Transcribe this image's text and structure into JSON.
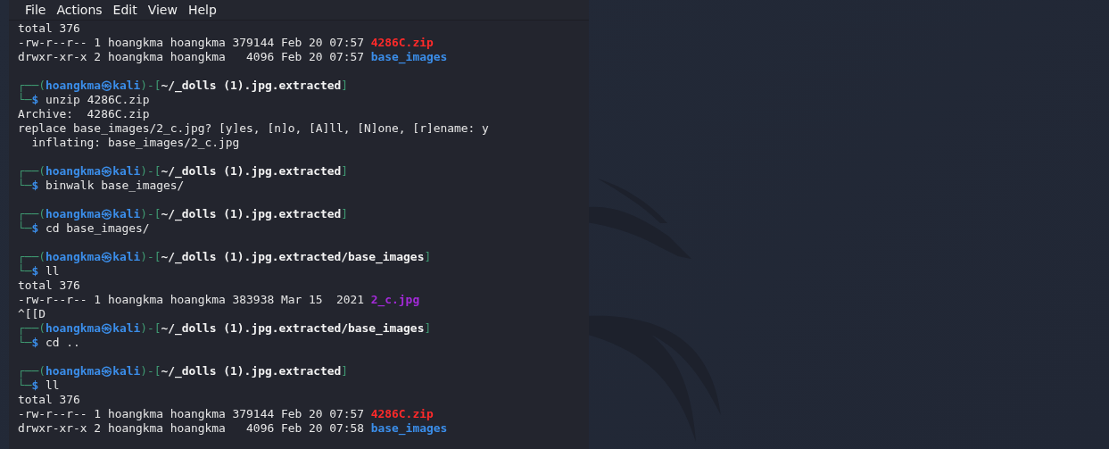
{
  "menu": [
    "File",
    "Actions",
    "Edit",
    "View",
    "Help"
  ],
  "lines": [
    {
      "kind": "output",
      "text": "total 376"
    },
    {
      "kind": "output",
      "text": "-rw-r--r-- 1 hoangkma hoangkma 379144 Feb 20 07:57 ",
      "file": {
        "name": "4286C.zip",
        "color": "#ff2a2a"
      }
    },
    {
      "kind": "output",
      "text": "drwxr-xr-x 2 hoangkma hoangkma   4096 Feb 20 07:57 ",
      "file": {
        "name": "base_images",
        "color": "#3b8eea"
      }
    },
    {
      "kind": "blank"
    },
    {
      "kind": "prompt",
      "open": "┌──(",
      "user": "hoangkma㉿kali",
      "mid": ")-[",
      "path": "~/_dolls (1).jpg.extracted",
      "close": "]",
      "corner": "└─",
      "dollar": "$",
      "command": "unzip 4286C.zip"
    },
    {
      "kind": "output",
      "text": "Archive:  4286C.zip"
    },
    {
      "kind": "output",
      "text": "replace base_images/2_c.jpg? [y]es, [n]o, [A]ll, [N]one, [r]ename: y"
    },
    {
      "kind": "output",
      "text": "  inflating: base_images/2_c.jpg"
    },
    {
      "kind": "blank"
    },
    {
      "kind": "prompt",
      "open": "┌──(",
      "user": "hoangkma㉿kali",
      "mid": ")-[",
      "path": "~/_dolls (1).jpg.extracted",
      "close": "]",
      "corner": "└─",
      "dollar": "$",
      "command": "binwalk base_images/"
    },
    {
      "kind": "blank"
    },
    {
      "kind": "prompt",
      "open": "┌──(",
      "user": "hoangkma㉿kali",
      "mid": ")-[",
      "path": "~/_dolls (1).jpg.extracted",
      "close": "]",
      "corner": "└─",
      "dollar": "$",
      "command": "cd base_images/"
    },
    {
      "kind": "blank"
    },
    {
      "kind": "prompt",
      "open": "┌──(",
      "user": "hoangkma㉿kali",
      "mid": ")-[",
      "path": "~/_dolls (1).jpg.extracted/base_images",
      "close": "]",
      "corner": "└─",
      "dollar": "$",
      "command": "ll"
    },
    {
      "kind": "output",
      "text": "total 376"
    },
    {
      "kind": "output",
      "text": "-rw-r--r-- 1 hoangkma hoangkma 383938 Mar 15  2021 ",
      "file": {
        "name": "2_c.jpg",
        "color": "#a32ad8"
      }
    },
    {
      "kind": "output",
      "text": "^[[D"
    },
    {
      "kind": "prompt",
      "open": "┌──(",
      "user": "hoangkma㉿kali",
      "mid": ")-[",
      "path": "~/_dolls (1).jpg.extracted/base_images",
      "close": "]",
      "corner": "└─",
      "dollar": "$",
      "command": "cd .."
    },
    {
      "kind": "blank"
    },
    {
      "kind": "prompt",
      "open": "┌──(",
      "user": "hoangkma㉿kali",
      "mid": ")-[",
      "path": "~/_dolls (1).jpg.extracted",
      "close": "]",
      "corner": "└─",
      "dollar": "$",
      "command": "ll"
    },
    {
      "kind": "output",
      "text": "total 376"
    },
    {
      "kind": "output",
      "text": "-rw-r--r-- 1 hoangkma hoangkma 379144 Feb 20 07:57 ",
      "file": {
        "name": "4286C.zip",
        "color": "#ff2a2a"
      }
    },
    {
      "kind": "output",
      "text": "drwxr-xr-x 2 hoangkma hoangkma   4096 Feb 20 07:58 ",
      "file": {
        "name": "base_images",
        "color": "#3b8eea"
      }
    }
  ]
}
